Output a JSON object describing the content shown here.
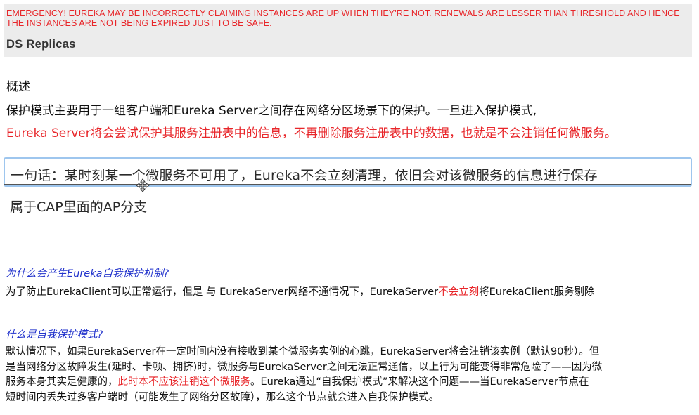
{
  "banner": {
    "warning": "EMERGENCY! EUREKA MAY BE INCORRECTLY CLAIMING INSTANCES ARE UP WHEN THEY'RE NOT. RENEWALS ARE LESSER THAN THRESHOLD AND HENCE THE INSTANCES ARE NOT BEING EXPIRED JUST TO BE SAFE.",
    "title": "DS Replicas"
  },
  "overview": {
    "heading": "概述",
    "line1": "保护模式主要用于一组客户端和Eureka Server之间存在网络分区场景下的保护。一旦进入保护模式,",
    "line2": "Eureka Server将会尝试保护其服务注册表中的信息，不再删除服务注册表中的数据，也就是不会注销任何微服务。"
  },
  "quote": {
    "text": "一句话：某时刻某一个微服务不可用了，Eureka不会立刻清理，依旧会对该微服务的信息进行保存",
    "cap": "属于CAP里面的AP分支"
  },
  "section1": {
    "heading": "为什么会产生Eureka自我保护机制?",
    "body_before": "为了防止EurekaClient可以正常运行，但是 与 EurekaServer网络不通情况下，EurekaServer",
    "body_red": "不会立刻",
    "body_after": "将EurekaClient服务剔除"
  },
  "section2": {
    "heading": "什么是自我保护模式?",
    "line1": "默认情况下，如果EurekaServer在一定时间内没有接收到某个微服务实例的心跳，EurekaServer将会注销该实例（默认90秒）。但",
    "line2": "是当网络分区故障发生(延时、卡顿、拥挤)时，微服务与EurekaServer之间无法正常通信，以上行为可能变得非常危险了——因为微",
    "line3_before": "服务本身其实是健康的，",
    "line3_red": "此时本不应该注销这个微服务",
    "line3_after": "。Eureka通过“自我保护模式”来解决这个问题——当EurekaServer节点在",
    "line4": "短时间内丢失过多客户端时（可能发生了网络分区故障），那么这个节点就会进入自我保护模式。"
  },
  "colors": {
    "warning_red": "#e8262a",
    "heading_blue": "#2233cc",
    "focus_border": "#9ec6ee",
    "banner_bg": "#ececec"
  },
  "icons": {
    "cursor": "move-cursor-icon"
  }
}
